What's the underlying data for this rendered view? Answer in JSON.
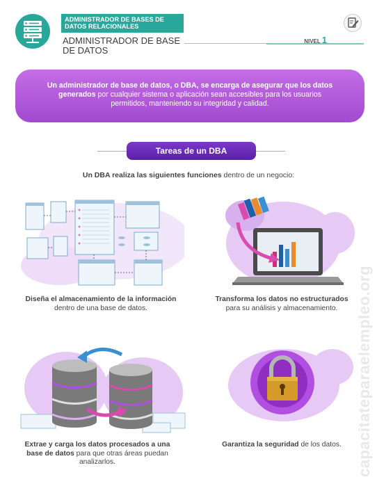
{
  "header": {
    "course_banner": "ADMINISTRADOR DE BASES DE DATOS RELACIONALES",
    "course_title": "ADMINISTRADOR DE BASE DE DATOS",
    "level_label": "NIVEL",
    "level_number": "1",
    "logo_icon": "server-icon",
    "edit_icon": "edit-note-icon"
  },
  "intro": {
    "part1": "Un administrador de base de datos, o DBA, se encarga de asegurar que los datos generados",
    "part2": " por cualquier sistema o aplicación sean accesibles para los usuarios permitidos, manteniendo su integridad y calidad."
  },
  "section": {
    "title": "Tareas de un DBA",
    "subtitle_bold": "Un DBA realiza las siguientes funciones",
    "subtitle_rest": " dentro de un negocio:"
  },
  "tasks": [
    {
      "bold": "Diseña el almacenamiento de la información",
      "rest": "dentro de una base de datos.",
      "icon": "database-schema-diagram-icon"
    },
    {
      "bold": "Transforma los datos no estructurados",
      "rest": "para su análisis y almacenamiento.",
      "icon": "laptop-bar-chart-icon"
    },
    {
      "bold": "Extrae y carga los datos procesados a una base de datos",
      "rest": " para que otras áreas puedan analizarlos.",
      "icon": "database-transfer-icon"
    },
    {
      "bold": "Garantiza la seguridad",
      "rest": " de los datos.",
      "icon": "padlock-icon"
    }
  ],
  "watermark": "capacitateparaelempleo.org",
  "colors": {
    "teal": "#27a89a",
    "purple": "#a24ad0",
    "dark_purple": "#5b1fa8",
    "light_purple": "#d9b3f0"
  }
}
